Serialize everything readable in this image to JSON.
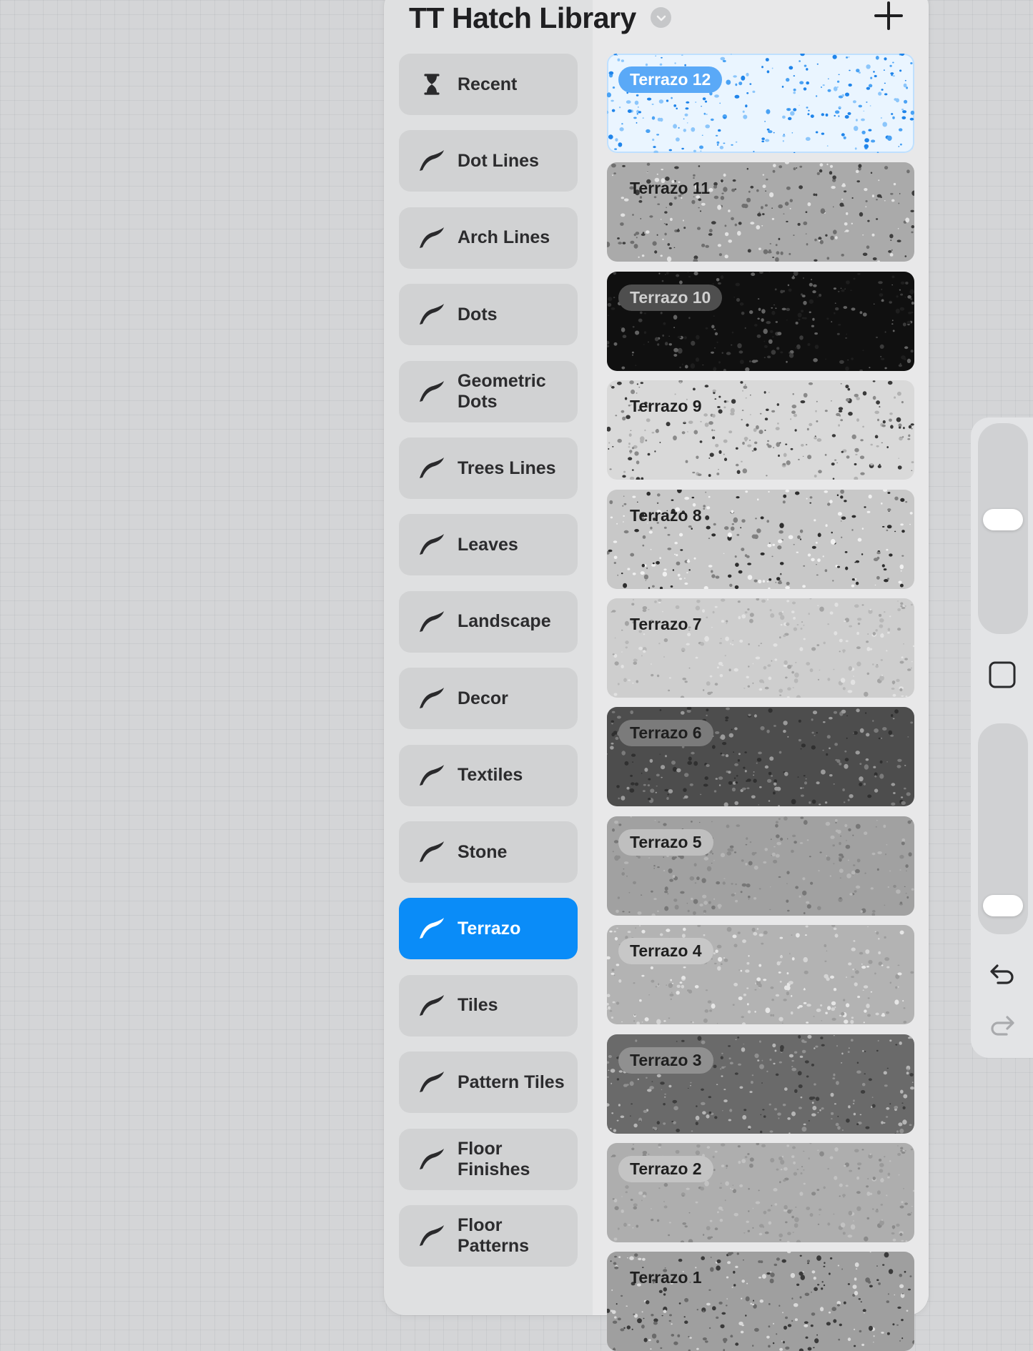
{
  "library": {
    "title": "TT Hatch Library",
    "title_chevron_icon": "chevron-down-icon",
    "add_icon": "plus-icon"
  },
  "categories": [
    {
      "label": "Recent",
      "icon": "hourglass-icon"
    },
    {
      "label": "Dot Lines",
      "icon": "brush-stroke-icon"
    },
    {
      "label": "Arch Lines",
      "icon": "brush-stroke-icon"
    },
    {
      "label": "Dots",
      "icon": "brush-stroke-icon"
    },
    {
      "label": "Geometric Dots",
      "icon": "brush-stroke-icon"
    },
    {
      "label": "Trees Lines",
      "icon": "brush-stroke-icon"
    },
    {
      "label": "Leaves",
      "icon": "brush-stroke-icon"
    },
    {
      "label": "Landscape",
      "icon": "brush-stroke-icon"
    },
    {
      "label": "Decor",
      "icon": "brush-stroke-icon"
    },
    {
      "label": "Textiles",
      "icon": "brush-stroke-icon"
    },
    {
      "label": "Stone",
      "icon": "brush-stroke-icon"
    },
    {
      "label": "Terrazo",
      "icon": "brush-stroke-icon",
      "selected": true
    },
    {
      "label": "Tiles",
      "icon": "brush-stroke-icon"
    },
    {
      "label": "Pattern Tiles",
      "icon": "brush-stroke-icon"
    },
    {
      "label": "Floor Finishes",
      "icon": "brush-stroke-icon"
    },
    {
      "label": "Floor Patterns",
      "icon": "brush-stroke-icon"
    }
  ],
  "brushes": [
    {
      "name": "Terrazo 12",
      "selected": true,
      "bg": "#eaf5ff",
      "chips": [
        "#8cc6fb",
        "#4aa2f4",
        "#1f84ea"
      ],
      "pill_bg": "#5aa9f7",
      "pill_fg": "#ffffff"
    },
    {
      "name": "Terrazo 11",
      "bg": "#aaaaaa",
      "chips": [
        "#e1e1e1",
        "#6f6f6f",
        "#3e3e3e"
      ],
      "pill_bg": "none",
      "pill_fg": "#1f1f1f"
    },
    {
      "name": "Terrazo 10",
      "bg": "#101010",
      "chips": [
        "#3a3a3a",
        "#626262",
        "#1e1e1e"
      ],
      "pill_bg": "#4e4e4e",
      "pill_fg": "#cfcfcf"
    },
    {
      "name": "Terrazo 9",
      "bg": "#d9d9d9",
      "chips": [
        "#8a8a8a",
        "#3a3a3a",
        "#b2b2b2"
      ],
      "pill_bg": "none",
      "pill_fg": "#1f1f1f"
    },
    {
      "name": "Terrazo 8",
      "bg": "#c8c8c8",
      "chips": [
        "#2e2e2e",
        "#808080",
        "#f0f0f0"
      ],
      "pill_bg": "none",
      "pill_fg": "#1f1f1f"
    },
    {
      "name": "Terrazo 7",
      "bg": "#cecece",
      "chips": [
        "#b8b8b8",
        "#e2e2e2",
        "#a4a4a4"
      ],
      "pill_bg": "none",
      "pill_fg": "#1f1f1f"
    },
    {
      "name": "Terrazo 6",
      "bg": "#4d4d4d",
      "chips": [
        "#7a7a7a",
        "#303030",
        "#9a9a9a"
      ],
      "pill_bg": "#7b7b7b",
      "pill_fg": "#1f1f1f"
    },
    {
      "name": "Terrazo 5",
      "bg": "#a1a1a1",
      "chips": [
        "#8c8c8c",
        "#b6b6b6",
        "#777777"
      ],
      "pill_bg": "#bfbfbf",
      "pill_fg": "#1f1f1f"
    },
    {
      "name": "Terrazo 4",
      "bg": "#b3b3b3",
      "chips": [
        "#d4d4d4",
        "#9c9c9c",
        "#e6e6e6"
      ],
      "pill_bg": "#c7c7c7",
      "pill_fg": "#1f1f1f"
    },
    {
      "name": "Terrazo 3",
      "bg": "#6a6a6a",
      "chips": [
        "#909090",
        "#3d3d3d",
        "#b5b5b5"
      ],
      "pill_bg": "#909090",
      "pill_fg": "#1f1f1f"
    },
    {
      "name": "Terrazo 2",
      "bg": "#aeaeae",
      "chips": [
        "#9a9a9a",
        "#c2c2c2",
        "#8a8a8a"
      ],
      "pill_bg": "#c4c4c4",
      "pill_fg": "#1f1f1f"
    },
    {
      "name": "Terrazo 1",
      "bg": "#9f9f9f",
      "chips": [
        "#3a3a3a",
        "#d9d9d9",
        "#6a6a6a"
      ],
      "pill_bg": "none",
      "pill_fg": "#1f1f1f"
    }
  ],
  "side_toolbar": {
    "brush_size_level": 0.55,
    "opacity_level": 0.06,
    "modify_button_icon": "square-icon",
    "undo_icon": "undo-arrow-icon",
    "redo_icon": "redo-arrow-icon"
  },
  "colors": {
    "accent": "#0a8cf8",
    "panel": "#dfe0e1",
    "category_bg": "#d1d2d3",
    "canvas": "#d4d5d7"
  }
}
